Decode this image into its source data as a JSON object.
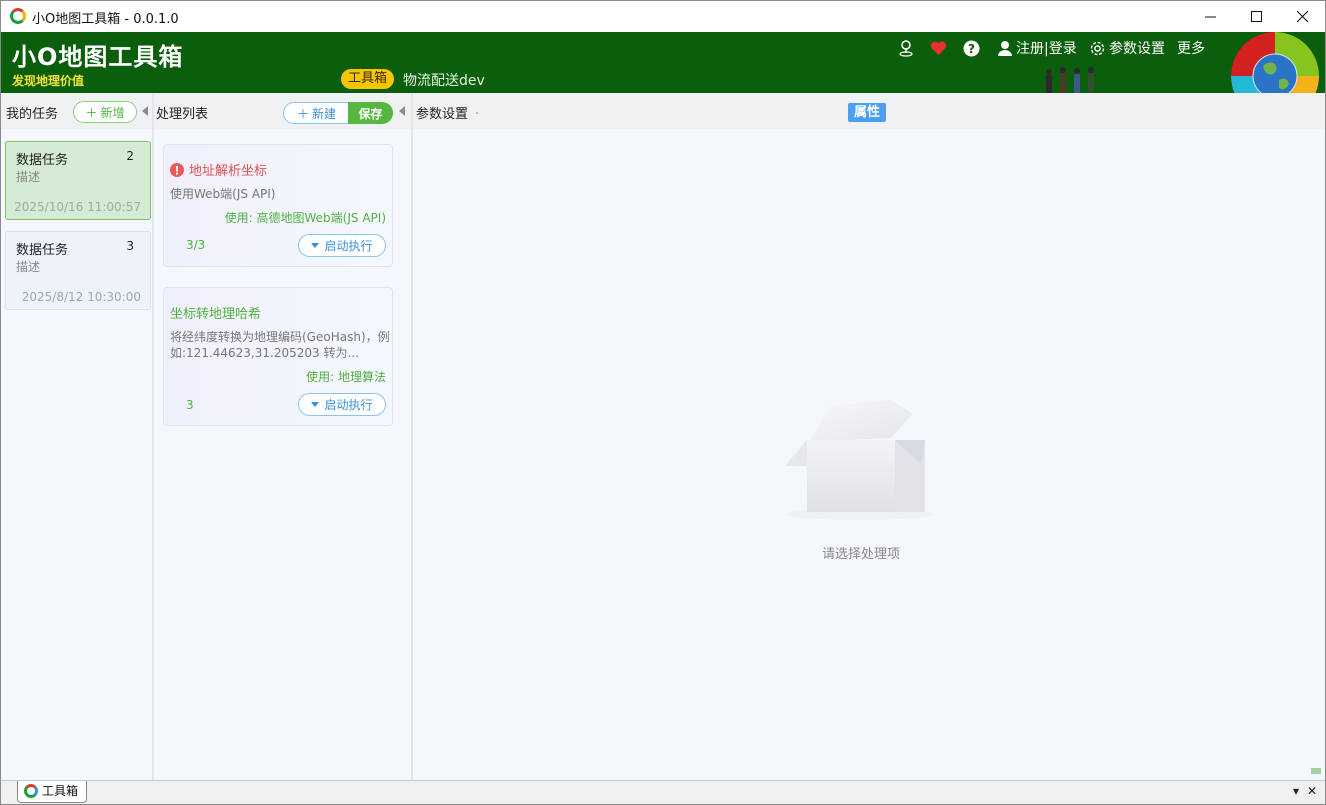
{
  "window": {
    "title": "小O地图工具箱 - 0.0.1.0"
  },
  "header": {
    "app_name": "小O地图工具箱",
    "slogan": "发现地理价值",
    "current_tag": "工具箱",
    "project": "物流配送dev",
    "register_login": "注册|登录",
    "settings": "参数设置",
    "more": "更多",
    "colors": {
      "bg": "#0b5e0b",
      "tag": "#f7c600",
      "slogan": "#f0e33c"
    }
  },
  "tasks_panel": {
    "label": "我的任务",
    "add_label": "新增",
    "items": [
      {
        "title": "数据任务",
        "count": "2",
        "desc": "描述",
        "date": "2025/10/16 11:00:57",
        "active": true
      },
      {
        "title": "数据任务",
        "count": "3",
        "desc": "描述",
        "date": "2025/8/12 10:30:00",
        "active": false
      }
    ]
  },
  "process_panel": {
    "label": "处理列表",
    "new_label": "新建",
    "save_label": "保存",
    "items": [
      {
        "title": "地址解析坐标",
        "desc": "使用Web端(JS API)",
        "uses": "使用: 高德地图Web端(JS API)",
        "count": "3/3",
        "run_label": "启动执行",
        "status": "error"
      },
      {
        "title": "坐标转地理哈希",
        "desc": "将经纬度转换为地理编码(GeoHash)，例如:121.44623,31.205203 转为...",
        "uses": "使用: 地理算法",
        "count": "3",
        "run_label": "启动执行",
        "status": "ok"
      }
    ]
  },
  "params_panel": {
    "label": "参数设置",
    "dot": ".",
    "attr_tag": "属性",
    "empty_text": "请选择处理项"
  },
  "bottom": {
    "tab_label": "工具箱",
    "dropdown": "▾",
    "close": "✕"
  }
}
